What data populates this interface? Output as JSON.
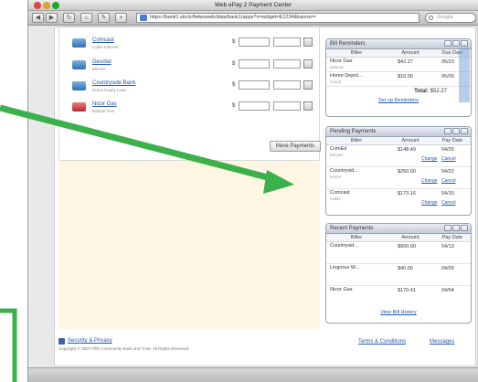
{
  "window": {
    "title": "Web ePay 2 Payment Center",
    "url": "https://bank1.stock/fwtwsweb/data/bank1/apps?v=widget=E1234&banner=",
    "search_placeholder": "Google"
  },
  "toolbar": {
    "back_icon": "back-arrow-icon",
    "forward_icon": "forward-arrow-icon",
    "reload_icon": "reload-icon",
    "home_icon": "home-icon",
    "add_icon": "plus-icon"
  },
  "payees": [
    {
      "name": "Comcast",
      "sub": "Cable Internet",
      "icon_color": "blue"
    },
    {
      "name": "Geodial",
      "sub": "Electric",
      "icon_color": "blue"
    },
    {
      "name": "Countryside Bank",
      "sub": "Home Equity Loan",
      "icon_color": "blue"
    },
    {
      "name": "Nicor Gas",
      "sub": "Natural Gas",
      "icon_color": "red"
    }
  ],
  "more_payments_label": "More Payments",
  "bill_reminders": {
    "title": "Bill Reminders",
    "columns": [
      "Biller",
      "Amount",
      "Due Date"
    ],
    "rows": [
      {
        "biller": "Nicor Gas",
        "sub": "Natural",
        "amount": "$42.27",
        "due": "05/23"
      },
      {
        "biller": "Home Depot...",
        "sub": "Credit",
        "amount": "$10.00",
        "due": "05/06"
      }
    ],
    "total_label": "Total:",
    "total_value": "$52.27",
    "link": "Set up Reminders"
  },
  "pending_payments": {
    "title": "Pending Payments",
    "columns": [
      "Biller",
      "Amount",
      "Pay Date"
    ],
    "rows": [
      {
        "biller": "ComEd",
        "sub": "Electric",
        "amount": "$148.49",
        "date": "04/25",
        "change": "Change",
        "cancel": "Cancel"
      },
      {
        "biller": "Countrysid...",
        "sub": "Home",
        "amount": "$250.00",
        "date": "04/22",
        "change": "Change",
        "cancel": "Cancel"
      },
      {
        "biller": "Comcast",
        "sub": "Cable",
        "amount": "$173.16",
        "date": "04/15",
        "change": "Change",
        "cancel": "Cancel"
      }
    ]
  },
  "recent_payments": {
    "title": "Recent Payments",
    "columns": [
      "Biller",
      "Amount",
      "Pay Date"
    ],
    "rows": [
      {
        "biller": "Countrysid...",
        "amount": "$900.00",
        "date": "04/13"
      },
      {
        "biller": "Lingonur W...",
        "amount": "$40.00",
        "date": "04/09"
      },
      {
        "biller": "Nicor Gas",
        "amount": "$170.41",
        "date": "04/04"
      }
    ],
    "link": "View Bill History"
  },
  "footer": {
    "security_link": "Security & Privacy",
    "copyright": "Copyright © 2007  Fifth Community Bank and Trust. All Rights Reserved.",
    "terms_link": "Terms & Conditions",
    "messages_link": "Messages"
  },
  "colors": {
    "annotation_arrow": "#3cb04a",
    "link": "#2357b0",
    "cream_bg": "#fdf6e3"
  }
}
